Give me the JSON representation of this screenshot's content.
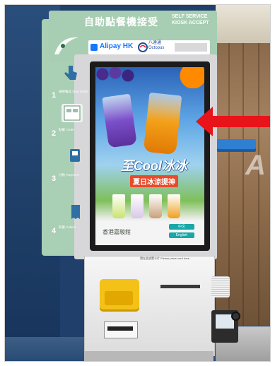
{
  "kiosk": {
    "title": "自助點餐機接受",
    "subtitle": "SELF SERVICE KIOSK ACCEPT",
    "payment": {
      "alipay": "Alipay HK",
      "octopus": "八達通 Octopus"
    },
    "steps": [
      {
        "num": "1",
        "text": "選擇餐品 Start Order"
      },
      {
        "num": "2",
        "text": "點餐 Order"
      },
      {
        "num": "3",
        "text": "付款 Payment"
      },
      {
        "num": "4",
        "text": "取餐 Collect"
      }
    ],
    "screen": {
      "promo_main": "至Cool冰冰",
      "promo_sub": "夏日冰涼提神",
      "footer_brand": "香港嘉駿館",
      "lang_buttons": [
        "中文",
        "English"
      ]
    },
    "label": "請在此放置卡片 Please place card here"
  },
  "colors": {
    "kiosk_green": "#a7ceb2",
    "arrow_red": "#e8141a",
    "card_reader_yellow": "#f3c117"
  }
}
